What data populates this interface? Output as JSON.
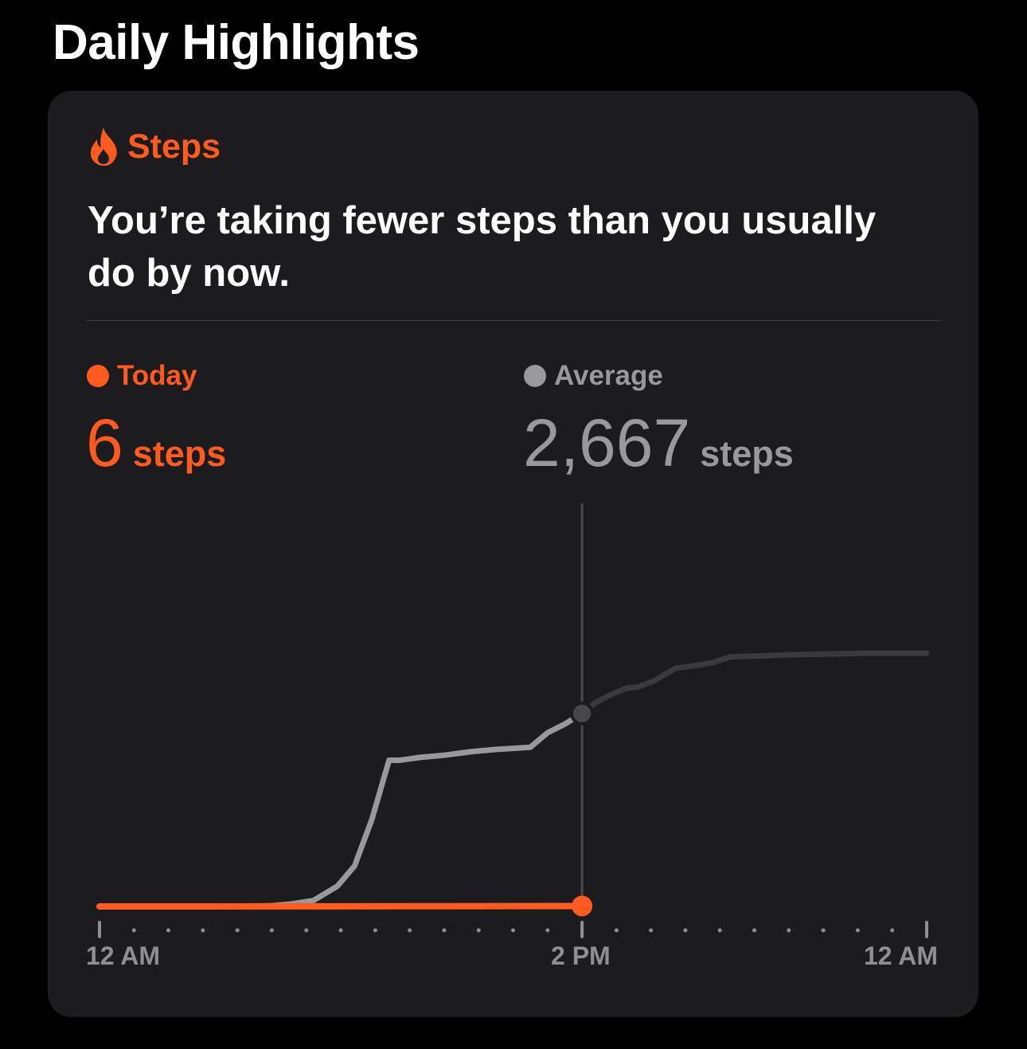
{
  "section": {
    "title": "Daily Highlights"
  },
  "card": {
    "icon": "flame-icon",
    "category": "Steps",
    "insight": "You’re taking fewer steps than you usually do by now.",
    "accent_color": "#ff5a1f",
    "average_color": "#98989d"
  },
  "today": {
    "label": "Today",
    "value": "6",
    "unit": "steps"
  },
  "average": {
    "label": "Average",
    "value": "2,667",
    "unit": "steps"
  },
  "chart_data": {
    "type": "line",
    "x_unit": "hour",
    "x_range": [
      0,
      24
    ],
    "ylim": [
      0,
      5560
    ],
    "x_tick_labels": [
      {
        "hour": 0,
        "label": "12 AM"
      },
      {
        "hour": 14,
        "label": "2 PM"
      },
      {
        "hour": 24,
        "label": "12 AM"
      }
    ],
    "current_hour": 14,
    "series": [
      {
        "name": "Average",
        "color_recent": "#98989d",
        "color_future": "#3a3a3c",
        "points": [
          [
            0,
            0
          ],
          [
            1,
            0
          ],
          [
            2,
            0
          ],
          [
            3,
            0
          ],
          [
            4,
            0
          ],
          [
            5,
            10
          ],
          [
            5.5,
            30
          ],
          [
            6.2,
            80
          ],
          [
            6.9,
            280
          ],
          [
            7.4,
            560
          ],
          [
            7.9,
            1200
          ],
          [
            8.4,
            2020
          ],
          [
            8.7,
            2020
          ],
          [
            9.3,
            2060
          ],
          [
            10,
            2090
          ],
          [
            10.8,
            2140
          ],
          [
            11.5,
            2170
          ],
          [
            12.5,
            2200
          ],
          [
            13,
            2400
          ],
          [
            13.5,
            2520
          ],
          [
            14,
            2667
          ],
          [
            14.4,
            2820
          ],
          [
            14.8,
            2920
          ],
          [
            15.3,
            3020
          ],
          [
            15.6,
            3030
          ],
          [
            16.1,
            3120
          ],
          [
            16.7,
            3290
          ],
          [
            17.3,
            3330
          ],
          [
            17.8,
            3370
          ],
          [
            18.3,
            3450
          ],
          [
            19,
            3460
          ],
          [
            20.2,
            3480
          ],
          [
            21.3,
            3490
          ],
          [
            22.2,
            3500
          ],
          [
            23,
            3500
          ],
          [
            24,
            3500
          ]
        ]
      },
      {
        "name": "Today",
        "color": "#ff5a1f",
        "points": [
          [
            0,
            0
          ],
          [
            7,
            1
          ],
          [
            10,
            3
          ],
          [
            14,
            6
          ]
        ]
      }
    ]
  }
}
